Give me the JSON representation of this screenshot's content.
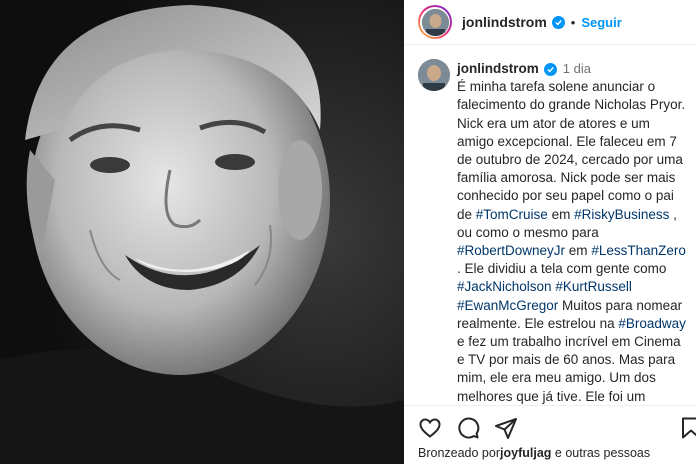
{
  "post": {
    "username": "jonlindstrom",
    "follow_label": "Seguir",
    "time_ago": "1 dia",
    "caption_parts": [
      {
        "t": "É minha tarefa solene anunciar o falecimento do grande Nicholas Pryor. Nick era um ator de atores e um amigo excepcional. Ele faleceu em 7 de outubro de 2024, cercado por uma família amorosa. Nick pode ser mais conhecido por seu papel como o pai de "
      },
      {
        "t": "#TomCruise",
        "tag": true
      },
      {
        "t": " em "
      },
      {
        "t": "#RiskyBusiness",
        "tag": true
      },
      {
        "t": " , ou como o mesmo para "
      },
      {
        "t": "#RobertDowneyJr",
        "tag": true
      },
      {
        "t": " em "
      },
      {
        "t": "#LessThanZero",
        "tag": true
      },
      {
        "t": " . Ele dividiu a tela com gente como "
      },
      {
        "t": "#JackNicholson",
        "tag": true
      },
      {
        "t": " "
      },
      {
        "t": "#KurtRussell",
        "tag": true
      },
      {
        "t": " "
      },
      {
        "t": "#EwanMcGregor",
        "tag": true
      },
      {
        "t": " Muitos para nomear realmente. Ele estrelou na "
      },
      {
        "t": "#Broadway",
        "tag": true
      },
      {
        "t": " e fez um trabalho incrível em Cinema e TV por mais de 60 anos. Mas para mim, ele era meu amigo. Um dos melhores que já tive. Ele foi um mentor, uma caixa de ressonância, um confidente de confiança e até mesmo uma figura paterna além, sim..."
      }
    ],
    "likes_prefix": "Bronzeado por",
    "likes_user": "joyfuljag",
    "likes_suffix": " e outras pessoas"
  },
  "icons": {
    "like": "heart-icon",
    "comment": "comment-icon",
    "share": "share-icon",
    "save": "bookmark-icon",
    "verified": "verified-badge-icon"
  },
  "colors": {
    "link": "#0095f6",
    "hashtag": "#00376b",
    "text": "#262626",
    "muted": "#737373"
  }
}
